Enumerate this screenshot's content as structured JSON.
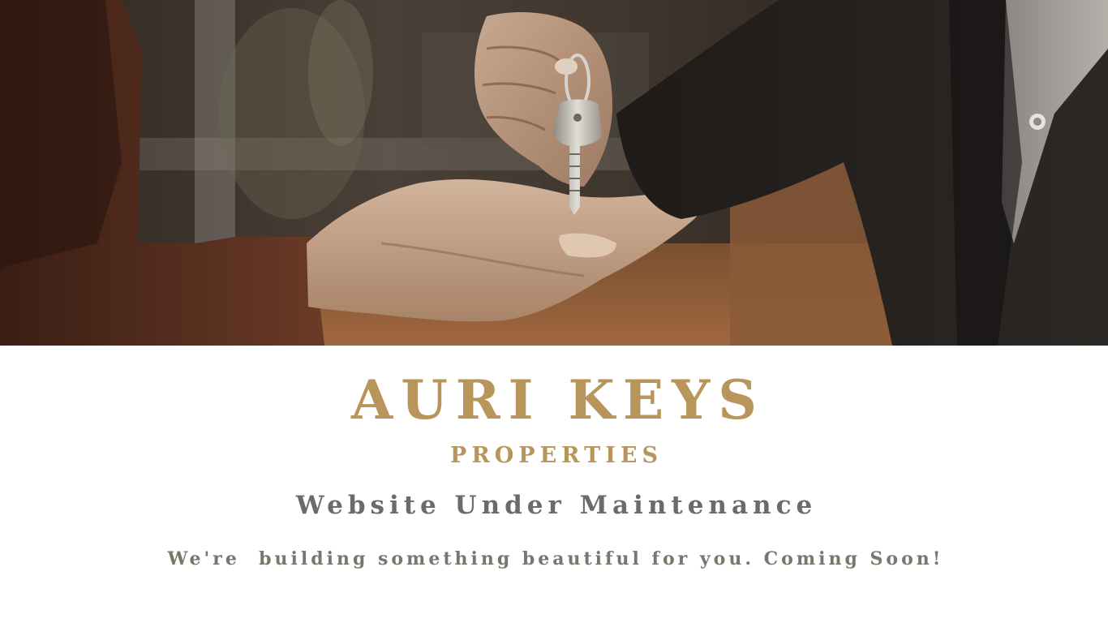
{
  "hero": {
    "image_icon": "key-handover-photo"
  },
  "brand": {
    "title": "AURI KEYS",
    "subtitle": "PROPERTIES"
  },
  "status": {
    "heading": "Website Under Maintenance",
    "message": "We're  building something beautiful for you. Coming Soon!"
  },
  "colors": {
    "gold": "#b8955a",
    "gray": "#6b6b6b",
    "dark_gray": "#7a766c"
  }
}
